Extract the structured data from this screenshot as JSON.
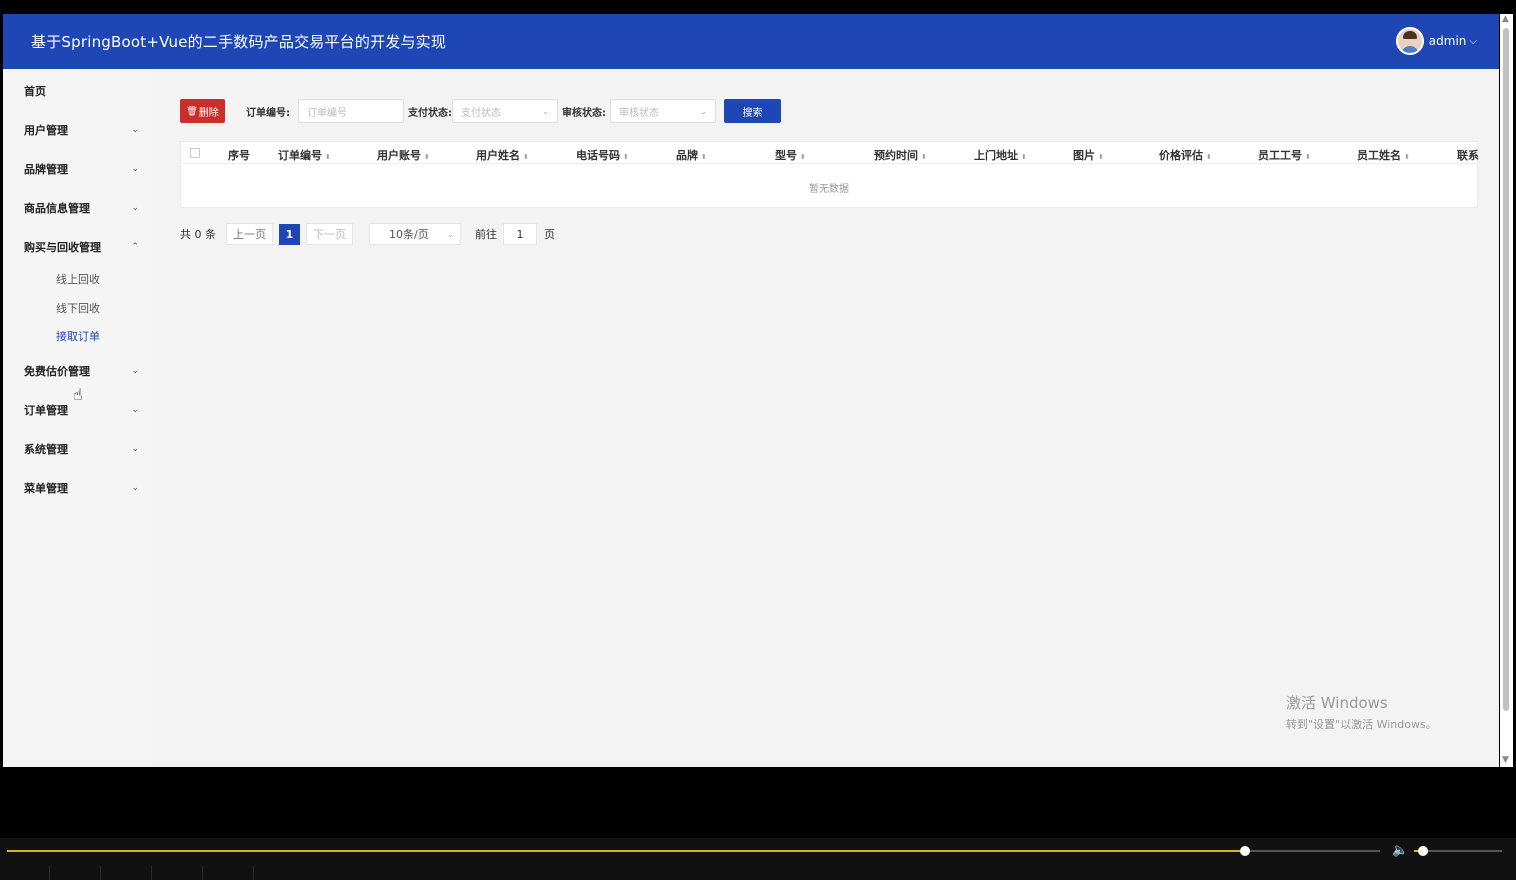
{
  "header": {
    "title": "基于SpringBoot+Vue的二手数码产品交易平台的开发与实现",
    "username": "admin"
  },
  "sidebar": {
    "items": [
      {
        "label": "首页"
      },
      {
        "label": "用户管理"
      },
      {
        "label": "品牌管理"
      },
      {
        "label": "商品信息管理"
      },
      {
        "label": "购买与回收管理"
      },
      {
        "label": "免费估价管理"
      },
      {
        "label": "订单管理"
      },
      {
        "label": "系统管理"
      },
      {
        "label": "菜单管理"
      }
    ],
    "subitems": [
      {
        "label": "线上回收"
      },
      {
        "label": "线下回收"
      },
      {
        "label": "接取订单"
      }
    ]
  },
  "toolbar": {
    "delete_label": "删除",
    "order_no_label": "订单编号:",
    "order_no_placeholder": "订单编号",
    "pay_status_label": "支付状态:",
    "pay_status_placeholder": "支付状态",
    "audit_status_label": "审核状态:",
    "audit_status_placeholder": "审核状态",
    "search_label": "搜索"
  },
  "table": {
    "columns": [
      "序号",
      "订单编号",
      "用户账号",
      "用户姓名",
      "电话号码",
      "品牌",
      "型号",
      "预约时间",
      "上门地址",
      "图片",
      "价格评估",
      "员工工号",
      "员工姓名",
      "联系"
    ],
    "empty_text": "暂无数据"
  },
  "pager": {
    "total": "共 0 条",
    "prev": "上一页",
    "current": "1",
    "next": "下一页",
    "page_size": "10条/页",
    "goto_label": "前往",
    "goto_value": "1",
    "page_suffix": "页"
  },
  "watermark": {
    "line1": "激活 Windows",
    "line2": "转到\"设置\"以激活 Windows。"
  },
  "player": {
    "progress": 0.902,
    "volume": 0.1
  }
}
